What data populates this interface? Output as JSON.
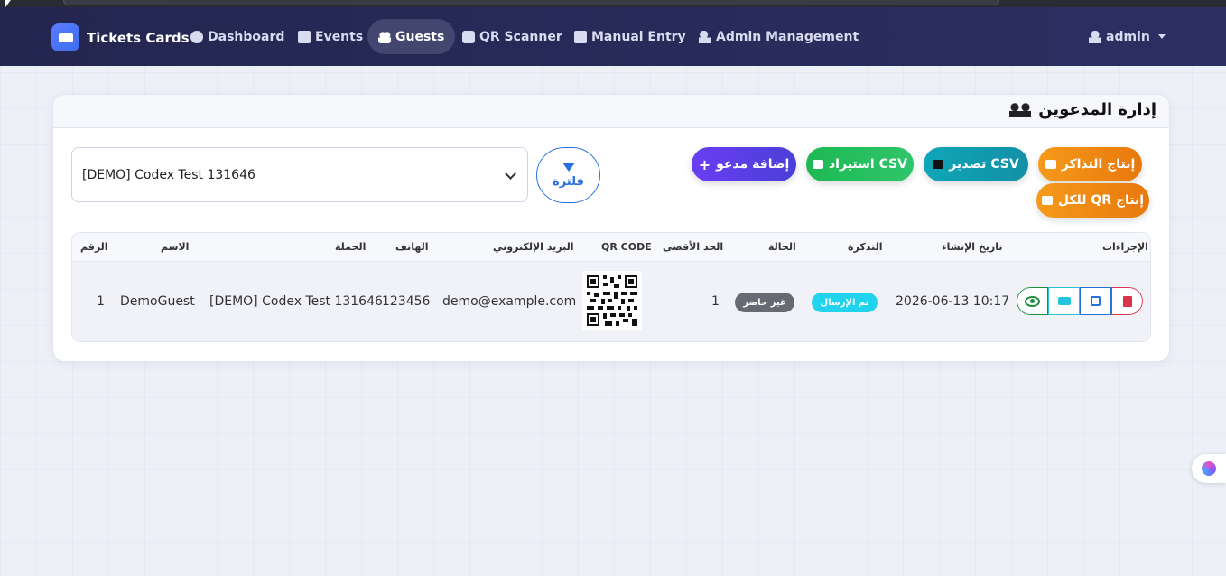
{
  "nav": {
    "brand": "Tickets Cards",
    "items": [
      {
        "label": "Dashboard"
      },
      {
        "label": "Events"
      },
      {
        "label": "Guests"
      },
      {
        "label": "QR Scanner"
      },
      {
        "label": "Manual Entry"
      },
      {
        "label": "Admin Management"
      }
    ],
    "user": "admin"
  },
  "page": {
    "title": "إدارة المدعوين"
  },
  "filter": {
    "selected_campaign": "[DEMO] Codex Test 131646",
    "filter_label": "فلترة"
  },
  "buttons": {
    "add_guest": "إضافة مدعو",
    "import_csv": "CSV استيراد",
    "export_csv": "CSV تصدير",
    "generate_tickets": "إنتاج التذاكر",
    "generate_qr_all": "إنتاج QR للكل"
  },
  "table": {
    "headers": {
      "index": "الرقم",
      "name": "الاسم",
      "campaign": "الحملة",
      "phone": "الهاتف",
      "email": "البريد الإلكتروني",
      "qr": "QR CODE",
      "max": "الحد الأقصى",
      "status": "الحالة",
      "ticket": "التذكرة",
      "created": "تاريخ الإنشاء",
      "actions": "الإجراءات"
    },
    "rows": [
      {
        "index": "1",
        "name": "DemoGuest",
        "campaign": "[DEMO] Codex Test 131646",
        "phone": "123456",
        "email": "demo@example.com",
        "max": "1",
        "status": "غير حاضر",
        "ticket": "تم الإرسال",
        "created": "2026-06-13 10:17"
      }
    ]
  },
  "colors": {
    "navbar": "#23264f",
    "primary": "#2a6fe0",
    "add": "#5a3fe6",
    "import": "#22c55e",
    "export": "#1398ad",
    "generate": "#ee8a14",
    "absent": "#666b73",
    "sent": "#22d3ee",
    "delete": "#d9344b"
  }
}
